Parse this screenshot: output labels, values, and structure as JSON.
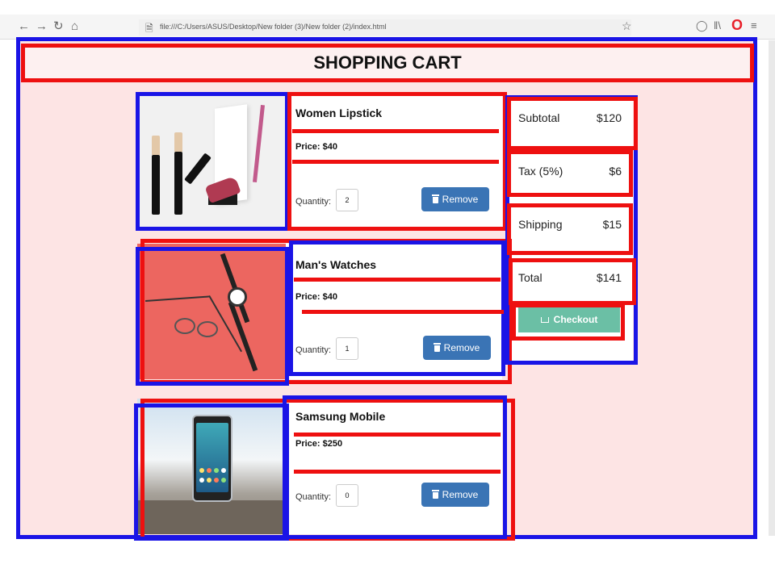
{
  "browser": {
    "url": "file:///C:/Users/ASUS/Desktop/New folder (3)/New folder (2)/index.html",
    "nav_icons": [
      "back-icon",
      "forward-icon",
      "reload-icon",
      "home-icon"
    ],
    "toolbar_icons": [
      "bookmark-star-icon",
      "pocket-icon",
      "library-icon",
      "opera-icon",
      "menu-icon"
    ]
  },
  "page": {
    "title": "SHOPPING CART",
    "background": "#fde4e4"
  },
  "products": [
    {
      "name": "Women Lipstick",
      "price": "Price: $40",
      "quantity_label": "Quantity:",
      "quantity": "2",
      "remove_label": "Remove"
    },
    {
      "name": "Man's Watches",
      "price": "Price: $40",
      "quantity_label": "Quantity:",
      "quantity": "1",
      "remove_label": "Remove"
    },
    {
      "name": "Samsung Mobile",
      "price": "Price: $250",
      "quantity_label": "Quantity:",
      "quantity": "0",
      "remove_label": "Remove"
    }
  ],
  "summary": {
    "subtotal_label": "Subtotal",
    "subtotal": "$120",
    "tax_label": "Tax (5%)",
    "tax": "$6",
    "shipping_label": "Shipping",
    "shipping": "$15",
    "total_label": "Total",
    "total": "$141",
    "checkout_label": "Checkout"
  },
  "colors": {
    "remove_button": "#3a74b5",
    "checkout_button": "#6bbfa5",
    "annotation_blue": "#1a14e6",
    "annotation_red": "#ee1010"
  }
}
